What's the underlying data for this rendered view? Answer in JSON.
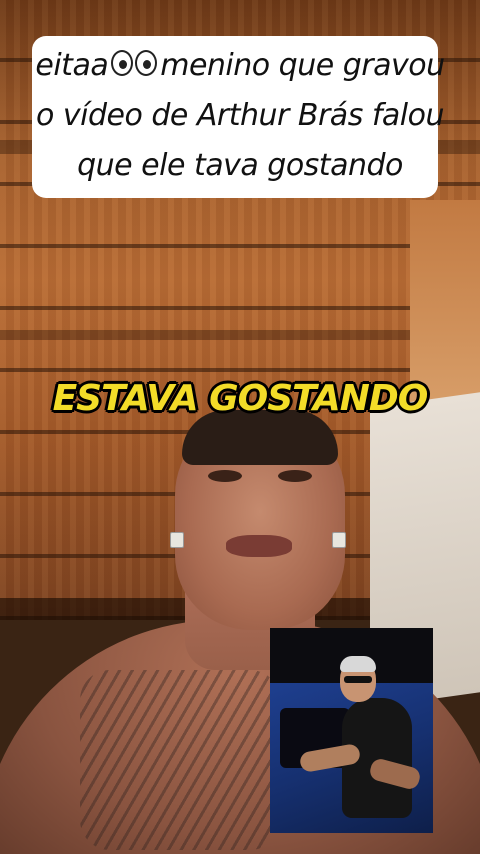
{
  "caption": {
    "line1_before": "eitaa",
    "line1_emoji": "eyes-emoji",
    "line1_after": "menino que gravou",
    "line2": "o vídeo de Arthur Brás falou",
    "line3": "que ele tava gostando"
  },
  "title": "ESTAVA GOSTANDO",
  "colors": {
    "title_yellow": "#f3dc28",
    "caption_bg": "#ffffff",
    "caption_text": "#111111"
  }
}
